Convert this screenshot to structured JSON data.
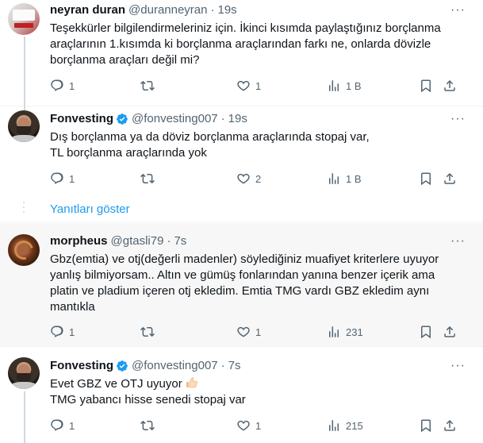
{
  "tweets": [
    {
      "name": "neyran duran",
      "handle": "@duranneyran",
      "time": "19s",
      "verified": false,
      "lines": [
        "Teşekkürler bilgilendirmeleriniz için. İkinci kısımda paylaştığınız borçlanma",
        "araçlarının 1.kısımda ki borçlanma araçlarından farkı ne, onlarda dövizle",
        "borçlanma araçları değil mi?"
      ],
      "replies": "1",
      "retweets": "",
      "likes": "1",
      "views": "1 B"
    },
    {
      "name": "Fonvesting",
      "handle": "@fonvesting007",
      "time": "19s",
      "verified": true,
      "lines": [
        "Dış borçlanma ya da döviz borçlanma araçlarında stopaj var,",
        "TL borçlanma araçlarında yok"
      ],
      "replies": "1",
      "retweets": "",
      "likes": "2",
      "views": "1 B"
    },
    {
      "name": "morpheus",
      "handle": "@gtasli79",
      "time": "7s",
      "verified": false,
      "lines": [
        "Gbz(emtia) ve otj(değerli madenler) söylediğiniz muafiyet  kriterlere uyuyor",
        "yanlış bilmiyorsam.. Altın ve gümüş fonlarından yanına benzer içerik ama",
        "platin ve pladium içeren otj ekledim. Emtia TMG vardı GBZ ekledim aynı",
        "mantıkla"
      ],
      "replies": "1",
      "retweets": "",
      "likes": "1",
      "views": "231"
    },
    {
      "name": "Fonvesting",
      "handle": "@fonvesting007",
      "time": "7s",
      "verified": true,
      "lines": [
        "Evet GBZ ve OTJ uyuyor",
        "TMG yabancı hisse senedi stopaj var"
      ],
      "emoji": "thumbs-up-emoji",
      "replies": "1",
      "retweets": "",
      "likes": "1",
      "views": "215"
    }
  ],
  "show_replies_label": "Yanıtları göster",
  "more_label": "···",
  "dot": "·",
  "colors": {
    "accent": "#1d9bf0",
    "muted": "#536471",
    "verified": "#1d9bf0"
  }
}
